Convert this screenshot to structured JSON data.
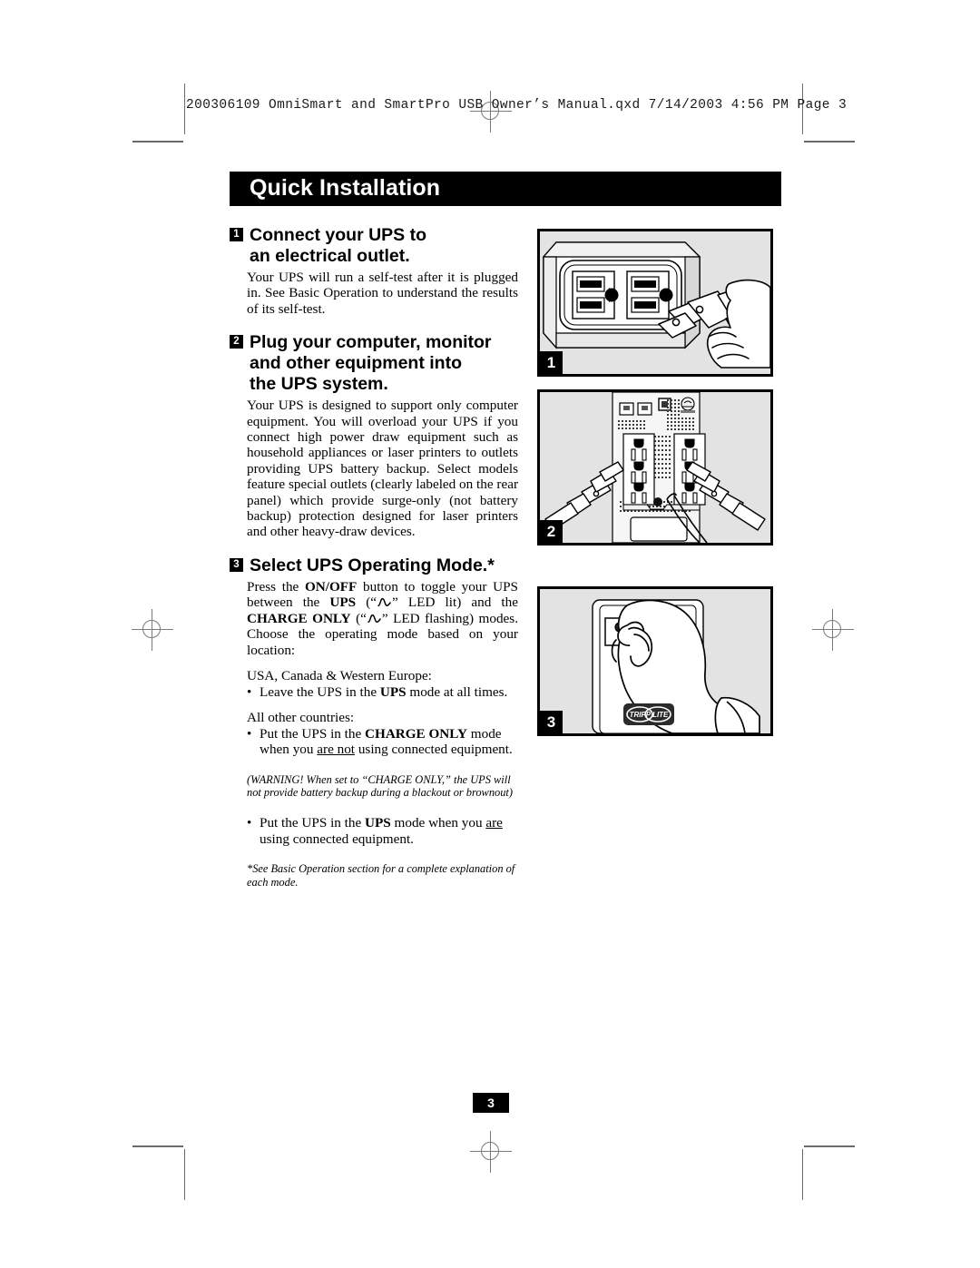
{
  "file_header": "200306109 OmniSmart and SmartPro USB Owner’s Manual.qxd  7/14/2003  4:56 PM  Page 3",
  "banner": {
    "title": "Quick Installation"
  },
  "steps": [
    {
      "number": "1",
      "heading_line1": "Connect your UPS to",
      "heading_line2": "an electrical outlet.",
      "body": "Your UPS will run a self-test after it is plugged in. See Basic Operation to understand the results of its self-test."
    },
    {
      "number": "2",
      "heading_line1": "Plug your computer, monitor",
      "heading_line2": "and other equipment into",
      "heading_line3": "the UPS system.",
      "body": "Your UPS is designed to support only computer equipment. You will overload your UPS if you connect high power draw equipment such as household appliances or laser printers to outlets providing UPS battery backup. Select models feature special outlets (clearly labeled on the rear panel) which provide surge-only (not battery backup) protection designed for laser printers and other heavy-draw devices."
    },
    {
      "number": "3",
      "heading_line1": "Select UPS Operating Mode.*",
      "intro_a": "Press the ",
      "intro_onoff": "ON/OFF",
      "intro_b": " button to toggle your UPS between the ",
      "intro_ups": "UPS",
      "intro_c": " (“",
      "intro_d": "” LED lit) and the ",
      "intro_charge": "CHARGE ONLY",
      "intro_e": " (“",
      "intro_f": "” LED flashing) modes. Choose the operating mode based on your location:",
      "region1_label": "USA, Canada & Western Europe:",
      "region1_bullet_a": "Leave the UPS in the ",
      "region1_bullet_mode": "UPS",
      "region1_bullet_b": " mode at all times.",
      "region2_label": "All other countries:",
      "region2_bullet_a": "Put the UPS in the ",
      "region2_bullet_mode": "CHARGE ONLY",
      "region2_bullet_b": " mode when you ",
      "region2_bullet_underline": "are not",
      "region2_bullet_c": " using connected equipment.",
      "warning": "(WARNING! When set to “CHARGE ONLY,” the UPS will not provide battery backup during a blackout or brownout)",
      "final_bullet_a": "Put the UPS in the ",
      "final_bullet_mode": "UPS",
      "final_bullet_b": " mode when you ",
      "final_bullet_underline": "are",
      "final_bullet_c": " using connected equipment.",
      "footnote": "*See Basic Operation section for a complete explanation of each mode."
    }
  ],
  "figures": [
    {
      "number": "1",
      "caption_alt": "Hand plugging UPS cord into a wall outlet"
    },
    {
      "number": "2",
      "caption_alt": "UPS rear panel with outlets and two equipment plugs"
    },
    {
      "number": "3",
      "caption_alt": "Hand pressing the ON/OFF button on UPS front panel"
    }
  ],
  "logo": {
    "text": "TRIPP LITE"
  },
  "footer": {
    "page_number": "3"
  },
  "colors": {
    "banner_bg": "#000000",
    "banner_text": "#ffffff",
    "figure_bg": "#e3e3e3",
    "figure_border": "#000000",
    "crop_mark": "#6b6b6b"
  }
}
